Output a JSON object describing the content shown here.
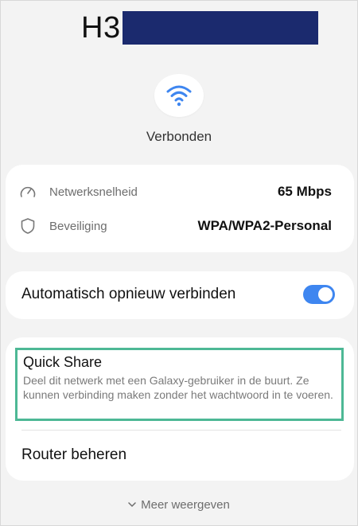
{
  "network": {
    "ssid_prefix": "H3",
    "status": "Verbonden"
  },
  "info": {
    "speed": {
      "label": "Netwerksnelheid",
      "value": "65 Mbps",
      "icon": "speedometer-icon"
    },
    "security": {
      "label": "Beveiliging",
      "value": "WPA/WPA2-Personal",
      "icon": "shield-icon"
    }
  },
  "auto_reconnect": {
    "label": "Automatisch opnieuw verbinden",
    "enabled": true
  },
  "quick_share": {
    "title": "Quick Share",
    "description": "Deel dit netwerk met een Galaxy-gebruiker in de buurt. Ze kunnen verbinding maken zonder het wachtwoord in te voeren."
  },
  "router": {
    "label": "Router beheren"
  },
  "more": {
    "label": "Meer weergeven"
  },
  "colors": {
    "accent": "#3e86f0",
    "highlight": "#4db895",
    "redaction": "#1b2a6e"
  }
}
